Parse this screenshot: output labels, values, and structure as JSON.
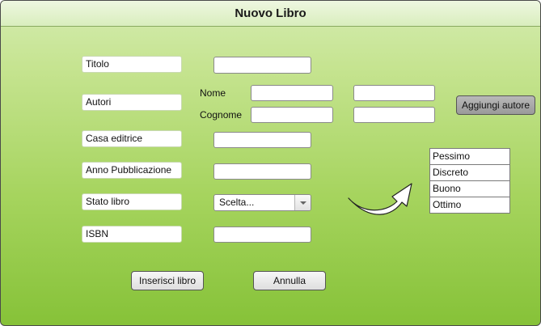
{
  "window": {
    "title": "Nuovo Libro"
  },
  "form": {
    "titolo_label": "Titolo",
    "autori_label": "Autori",
    "nome_label": "Nome",
    "cognome_label": "Cognome",
    "casa_editrice_label": "Casa editrice",
    "anno_label": "Anno Pubblicazione",
    "stato_label": "Stato libro",
    "stato_selected": "Scelta...",
    "isbn_label": "ISBN"
  },
  "buttons": {
    "aggiungi_autore": "Aggiungi autore",
    "inserisci": "Inserisci libro",
    "annulla": "Annulla"
  },
  "stato_options": [
    "Pessimo",
    "Discreto",
    "Buono",
    "Ottimo"
  ],
  "colors": {
    "gradient_top": "#d4ecb0",
    "gradient_bottom": "#86c238"
  }
}
